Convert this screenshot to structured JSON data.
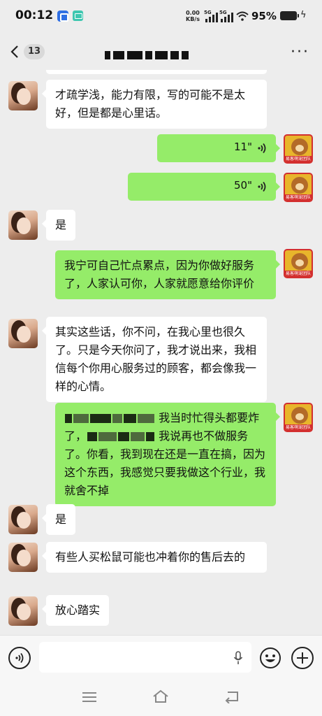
{
  "status_bar": {
    "time": "00:12",
    "net_speed_value": "0.00",
    "net_speed_unit": "KB/s",
    "signal1_label": "5G",
    "signal2_label": "5G",
    "battery": "95%"
  },
  "header": {
    "unread_count": "13"
  },
  "messages": [
    {
      "side": "left",
      "type": "text",
      "text": "才疏学浅，能力有限，写的可能不是太好，但是都是心里话。"
    },
    {
      "side": "right",
      "type": "voice",
      "duration": "11\""
    },
    {
      "side": "right",
      "type": "voice",
      "duration": "50\""
    },
    {
      "side": "left",
      "type": "text",
      "text": "是"
    },
    {
      "side": "right",
      "type": "text",
      "text": "我宁可自己忙点累点，因为你做好服务了，人家认可你，人家就愿意给你评价"
    },
    {
      "side": "left",
      "type": "text",
      "text": "其实这些话，你不问，在我心里也很久了。只是今天你问了，我才说出来，我相信每个你用心服务过的顾客，都会像我一样的心情。"
    },
    {
      "side": "right",
      "type": "text",
      "text_a": "我当时忙得头都要炸了，",
      "text_b": "我说再也不做服务了。你看，我到现在还是一直在搞，因为这个东西，我感觉只要我做这个行业，我就舍不掉"
    },
    {
      "side": "left",
      "type": "text",
      "text": "是"
    },
    {
      "side": "left",
      "type": "text",
      "text": "有些人买松鼠可能也冲着你的售后去的"
    },
    {
      "side": "left",
      "type": "text",
      "text": "放心踏实"
    }
  ],
  "right_avatar_caption": "易客萌宠团队",
  "colors": {
    "background": "#ededed",
    "bubble_self": "#95ec69",
    "bubble_other": "#ffffff"
  },
  "icons": {
    "back": "chevron-left-icon",
    "more": "more-dots-icon",
    "voice_input": "voice-input-icon",
    "mic": "microphone-icon",
    "emoji": "emoji-icon",
    "plus": "plus-icon"
  }
}
